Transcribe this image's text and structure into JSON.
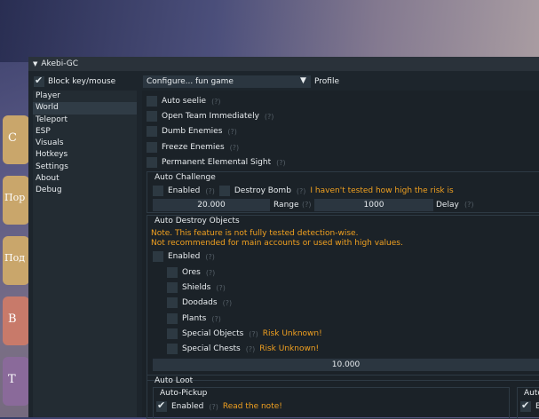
{
  "window": {
    "title": "Akebi-GC"
  },
  "toolbar": {
    "block_label": "Block key/mouse",
    "configure_label": "Configure...",
    "profile_value": "fun game",
    "profile_label": "Profile"
  },
  "sidebar": {
    "items": [
      "Player",
      "World",
      "Teleport",
      "ESP",
      "Visuals",
      "Hotkeys",
      "Settings",
      "About",
      "Debug"
    ]
  },
  "world": {
    "checkboxes": [
      "Auto seelie",
      "Open Team Immediately",
      "Dumb Enemies",
      "Freeze Enemies",
      "Permanent Elemental Sight"
    ],
    "help": "(?)"
  },
  "auto_challenge": {
    "title": "Auto Challenge",
    "enabled_label": "Enabled",
    "destroy_bomb_label": "Destroy Bomb",
    "warning": "I haven't tested how high the risk is",
    "range_value": "20.000",
    "range_label": "Range",
    "delay_value": "1000",
    "delay_label": "Delay"
  },
  "auto_destroy": {
    "title": "Auto Destroy Objects",
    "note1": "Note. This feature is not fully tested detection-wise.",
    "note2": "Not recommended for main accounts or used with high values.",
    "enabled_label": "Enabled",
    "items": [
      "Ores",
      "Shields",
      "Doodads",
      "Plants",
      "Special Objects",
      "Special Chests"
    ],
    "risk": "Risk Unknown!",
    "range_value": "10.000"
  },
  "auto_loot": {
    "title": "Auto Loot",
    "pickup_title": "Auto-Pickup",
    "enabled_label": "Enabled",
    "note": "Read the note!",
    "right_title": "Auto",
    "right_enabled": "E"
  },
  "background": {
    "tiles": [
      "С",
      "Пор",
      "Под",
      "В",
      "Т"
    ]
  }
}
